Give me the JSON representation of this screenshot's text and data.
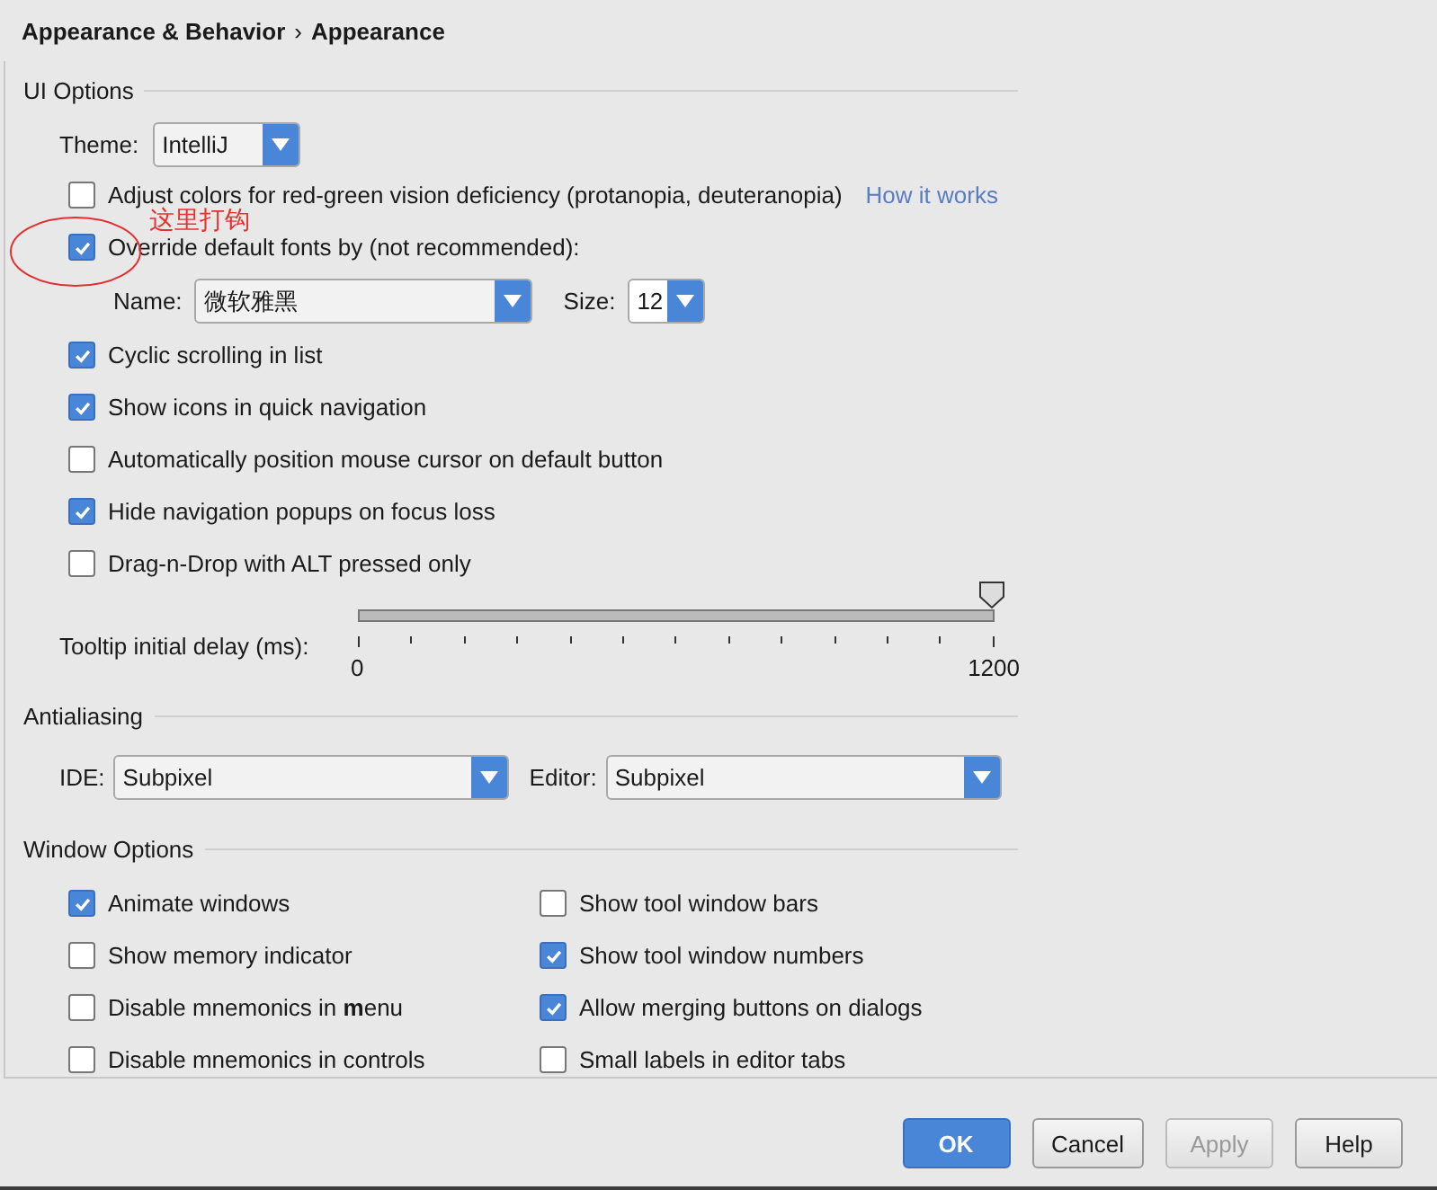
{
  "breadcrumb": {
    "parent": "Appearance & Behavior",
    "separator": "›",
    "current": "Appearance"
  },
  "ui_options": {
    "title": "UI Options",
    "theme": {
      "label": "Theme:",
      "value": "IntelliJ"
    },
    "items": [
      {
        "kind": "checkbox",
        "label": "Adjust colors for red-green vision deficiency (protanopia, deuteranopia)",
        "checked": false,
        "link": "How it works"
      },
      {
        "kind": "checkbox",
        "label": "Override default fonts by (not recommended):",
        "checked": true
      },
      {
        "kind": "font",
        "name_label": "Name:",
        "name_value": "微软雅黑",
        "size_label": "Size:",
        "size_value": "12"
      },
      {
        "kind": "checkbox",
        "label": "Cyclic scrolling in list",
        "checked": true
      },
      {
        "kind": "checkbox",
        "label": "Show icons in quick navigation",
        "checked": true
      },
      {
        "kind": "checkbox",
        "label": "Automatically position mouse cursor on default button",
        "checked": false
      },
      {
        "kind": "checkbox",
        "label": "Hide navigation popups on focus loss",
        "checked": true
      },
      {
        "kind": "checkbox",
        "label": "Drag-n-Drop with ALT pressed only",
        "checked": false
      }
    ],
    "tooltip_delay": {
      "label": "Tooltip initial delay (ms):",
      "level": 1,
      "min": "0",
      "max": "1200"
    }
  },
  "antialiasing": {
    "title": "Antialiasing",
    "fields": [
      {
        "label": "IDE:",
        "value": "Subpixel"
      },
      {
        "label": "Editor:",
        "value": "Subpixel"
      }
    ]
  },
  "window_options": {
    "title": "Window Options",
    "options": [
      {
        "label": "Animate windows",
        "checked": true
      },
      {
        "label": "Show tool window bars",
        "checked": false
      },
      {
        "label": "Show memory indicator",
        "checked": false
      },
      {
        "label": "Show tool window numbers",
        "checked": true
      },
      {
        "label": "Disable mnemonics in **m**enu",
        "checked": false
      },
      {
        "label": "Allow merging buttons on dialogs",
        "checked": true
      },
      {
        "label": "Disable mnemonics in controls",
        "checked": false
      },
      {
        "label": "Small labels in editor tabs",
        "checked": false
      }
    ]
  },
  "annotation": {
    "text": "这里打钩"
  },
  "buttons": [
    {
      "label": "OK",
      "default": true,
      "disabled": false
    },
    {
      "label": "Cancel",
      "default": false,
      "disabled": false
    },
    {
      "label": "Apply",
      "default": false,
      "disabled": true
    },
    {
      "label": "Help",
      "default": false,
      "disabled": false
    }
  ]
}
